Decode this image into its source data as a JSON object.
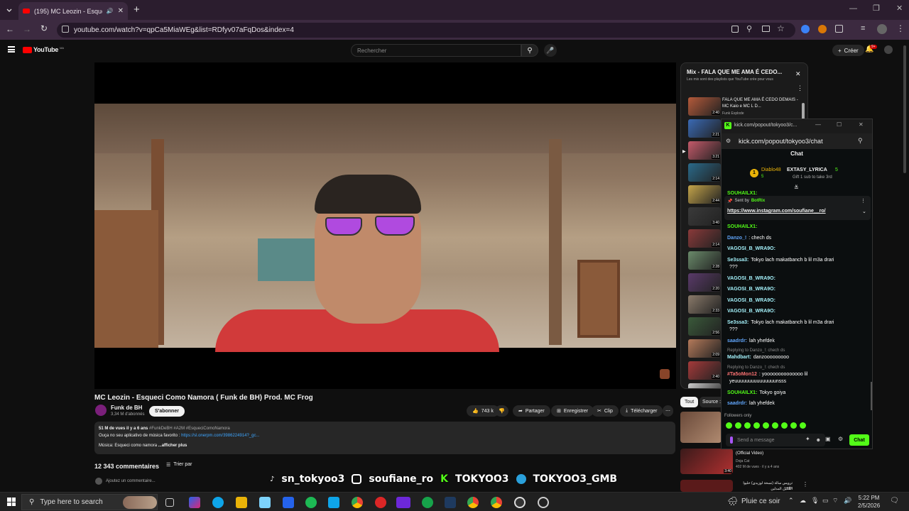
{
  "browser": {
    "tab_title": "(195) MC Leozin - Esqueci C",
    "url": "youtube.com/watch?v=qpCa5MiaWEg&list=RDfyv07aFqDos&index=4"
  },
  "youtube": {
    "logo": "YouTube",
    "logo_sup": "MA",
    "search_placeholder": "Rechercher",
    "create_label": "Créer",
    "notif_count": "9+",
    "video_title": "MC Leozin - Esqueci Como Namora ( Funk de BH) Prod. MC Frog",
    "channel_name": "Funk de BH",
    "subscribers": "3,34 M d'abonnés",
    "subscribe_label": "S'abonner",
    "likes": "743 k",
    "share_label": "Partager",
    "save_label": "Enregistrer",
    "clip_label": "Clip",
    "download_label": "Télécharger",
    "desc_stats": "51 M de vues  il y a 6 ans",
    "desc_tags": "#FunkDeBH #A2M #EsqueciComoNamora",
    "desc_line2": "Ouça no seu aplicativo de música favorito :",
    "desc_link": "https://sl.onerpm.com/3986224914?_gc...",
    "desc_music": "Música: Esqueci como namora",
    "desc_more": "...afficher plus",
    "comments_count": "12 343 commentaires",
    "sort_label": "Trier par",
    "add_comment": "Ajoutez un commentaire..."
  },
  "playlist": {
    "title": "Mix - FALA QUE ME AMA É CEDO...",
    "subtitle": "Les mix sont des playlists que YouTube crée pour vous",
    "first_title": "FALA QUE ME AMA É CEDO DEMAIS - MC Kaio e MC L D...",
    "first_channel": "Funk Explode",
    "durations": [
      "2:40",
      "2:21",
      "3:21",
      "2:14",
      "2:44",
      "3:40",
      "2:14",
      "2:28",
      "2:20",
      "2:33",
      "2:56",
      "2:09",
      "2:40",
      ""
    ]
  },
  "chips": {
    "all": "Tout",
    "source": "Source :"
  },
  "recommend": {
    "title2": "(Official Video)",
    "channel2": "Doja Cat",
    "meta2": "402 M de vues · il y a 4 ans",
    "dur2": "3:40",
    "title3": "ترويس سالة (نسخة لوزيدي) خليوا بنقبت",
    "title3b": "القلتين المدلين"
  },
  "kick": {
    "window_title": "kick.com/popout/tokyoo3/c...",
    "url": "kick.com/popout/tokyoo3/chat",
    "chat_header": "Chat",
    "gift_user1": "Diablo48",
    "gift_count1": "5",
    "gift_user2": "EXTASY_LYRICA",
    "gift_count2": "5",
    "gift_text": "Gift 1 sub to take 3rd",
    "pinned_user": "SOUHAILX1:",
    "pinned_sent": "Sent by",
    "pinned_bot": "BotRix",
    "pinned_link": "https://www.instagram.com/soufiane__ro/",
    "messages": [
      {
        "user": "SOUHAILX1:",
        "text": "",
        "color": "#53fc18"
      },
      {
        "user": "Danzo_!",
        "text": ": chech ds",
        "color": "#60a5fa"
      },
      {
        "user": "VAGOSI_B_WRA9O:",
        "text": "",
        "color": "#a5f3fc"
      },
      {
        "user": "Se3ssa3:",
        "text": "Tokyo lach makatbanch b lil m3a drari",
        "color": "#a5f3fc"
      },
      {
        "user": "",
        "text": "???",
        "color": "#fff"
      },
      {
        "user": "VAGOSI_B_WRA9O:",
        "text": "",
        "color": "#a5f3fc"
      },
      {
        "user": "VAGOSI_B_WRA9O:",
        "text": "",
        "color": "#a5f3fc"
      },
      {
        "user": "VAGOSI_B_WRA9O:",
        "text": "",
        "color": "#a5f3fc"
      },
      {
        "user": "VAGOSI_B_WRA9O:",
        "text": "",
        "color": "#a5f3fc"
      },
      {
        "user": "Se3ssa3:",
        "text": "Tokyo lach makatbanch b lil m3a drari",
        "color": "#a5f3fc"
      },
      {
        "user": "",
        "text": "???",
        "color": "#fff"
      },
      {
        "user": "saadrdr:",
        "text": "lah yhefdek",
        "color": "#60a5fa"
      },
      {
        "user": "Replying to Danzo_!: chech ds",
        "text": "",
        "color": "#888"
      },
      {
        "user": "Mahdbart:",
        "text": "danzooooooooo",
        "color": "#a5f3fc"
      },
      {
        "user": "Replying to Danzo_!: chech ds",
        "text": "",
        "color": "#888"
      },
      {
        "user": "#Ta5oMon12",
        "text": ": yoooooooooooooo lil",
        "color": "#f87171"
      },
      {
        "user": "",
        "text": "yeuuuuuuuuuuuuuuunsss",
        "color": "#fff"
      },
      {
        "user": "SOUHAILX1:",
        "text": "Tokyo goiya",
        "color": "#53fc18"
      },
      {
        "user": "saadrdr:",
        "text": "lah yhefdek",
        "color": "#60a5fa"
      }
    ],
    "followers_only": "Followers only",
    "input_placeholder": "Send a message",
    "chat_button": "Chat"
  },
  "overlay": {
    "tiktok": "sn_tokyoo3",
    "instagram": "soufiane_ro",
    "kick": "TOKYOO3",
    "telegram": "TOKYOO3_GMB"
  },
  "taskbar": {
    "search_placeholder": "Type here to search",
    "weather": "Pluie ce soir",
    "time": "5:22 PM",
    "date": "2/5/2026"
  }
}
